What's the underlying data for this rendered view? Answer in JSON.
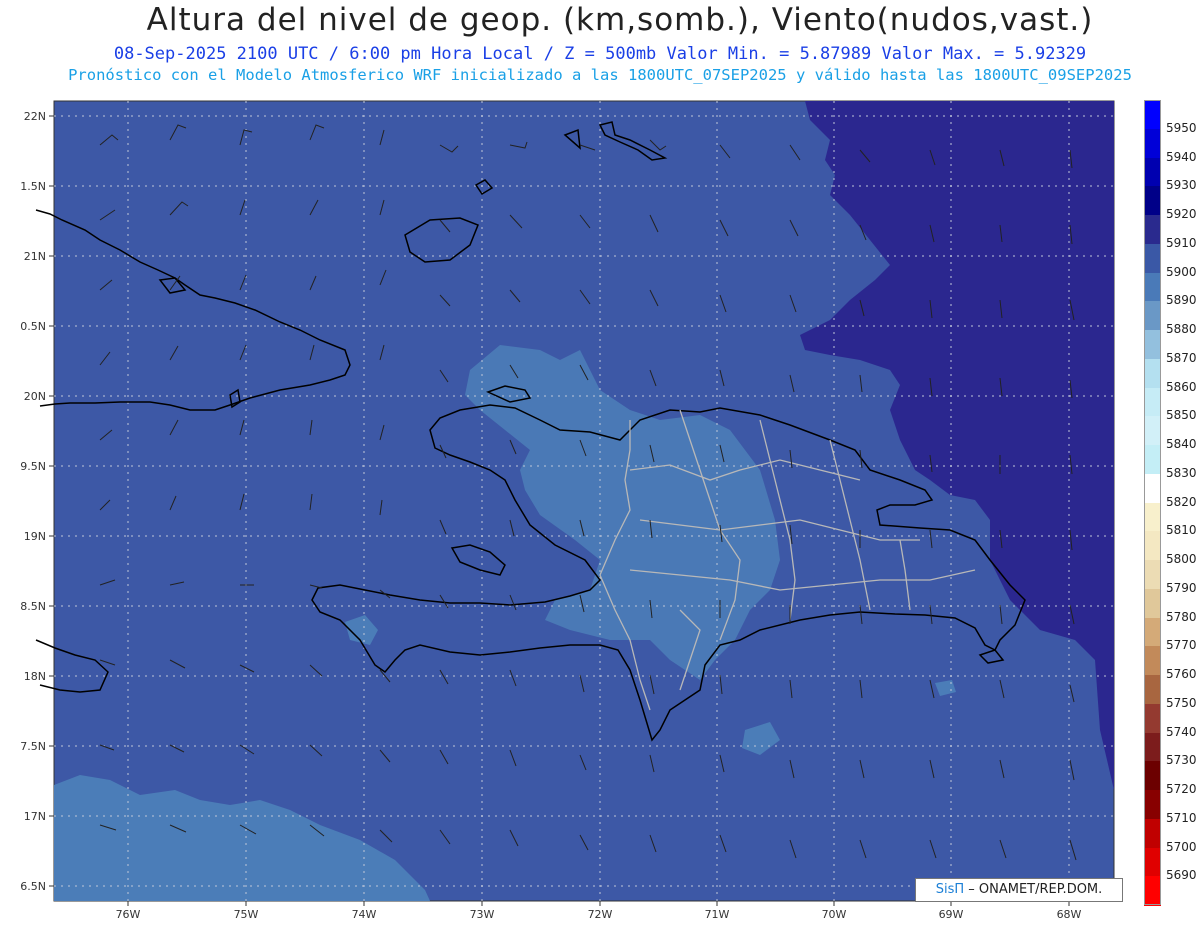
{
  "header": {
    "title": "Altura del nivel de geop. (km,somb.), Viento(nudos,vast.)",
    "line1": "08-Sep-2025  2100 UTC / 6:00 pm Hora Local / Z = 500mb    Valor Min. = 5.87989  Valor Max. = 5.92329",
    "line2": "Pronóstico con el Modelo Atmosferico WRF inicializado a las 1800UTC_07SEP2025 y válido hasta las  1800UTC_09SEP2025"
  },
  "axes": {
    "lat_labels": [
      "22N",
      "1.5N",
      "21N",
      "0.5N",
      "20N",
      "9.5N",
      "19N",
      "8.5N",
      "18N",
      "7.5N",
      "17N",
      "6.5N"
    ],
    "lon_labels": [
      "76W",
      "75W",
      "74W",
      "73W",
      "72W",
      "71W",
      "70W",
      "69W",
      "68W"
    ]
  },
  "legend": {
    "labels": [
      "5950",
      "5940",
      "5930",
      "5920",
      "5910",
      "5900",
      "5890",
      "5880",
      "5870",
      "5860",
      "5850",
      "5840",
      "5830",
      "5820",
      "5810",
      "5800",
      "5790",
      "5780",
      "5770",
      "5760",
      "5750",
      "5740",
      "5730",
      "5720",
      "5710",
      "5700",
      "5690"
    ],
    "colors": [
      "#0000ff",
      "#0000d8",
      "#0000b0",
      "#000088",
      "#2a2a8e",
      "#3a58a6",
      "#4a7ab8",
      "#6a98c6",
      "#93c0de",
      "#b4e0f0",
      "#c6ecf6",
      "#d2f0f8",
      "#c4eef6",
      "#ffffff",
      "#f8f0cc",
      "#f4e8c2",
      "#ecdcb4",
      "#e0c89a",
      "#d4aa78",
      "#c28a5a",
      "#a86640",
      "#943a30",
      "#7c1c1c",
      "#6c0000",
      "#880000",
      "#c00000",
      "#e00000",
      "#ff0000"
    ]
  },
  "credit": {
    "logo": "SisΠ",
    "org": "– ONAMET/REP.DOM."
  },
  "colors": {
    "base": "#3d58a6",
    "high": "#2b278f",
    "low": "#4b7db8"
  }
}
